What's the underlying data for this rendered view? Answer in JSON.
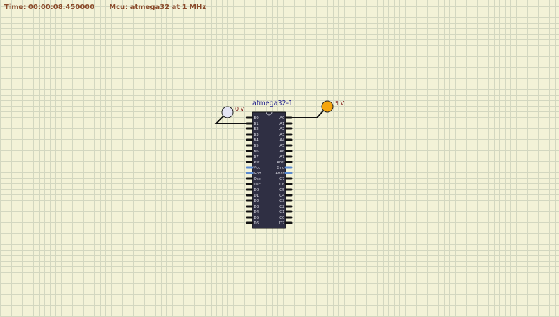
{
  "status": {
    "time": "Time: 00:00:08.450000",
    "mcu": "Mcu: atmega32 at 1 MHz"
  },
  "chip": {
    "name": "atmega32-1",
    "left_pins": [
      "B0",
      "B1",
      "B2",
      "B3",
      "B4",
      "B5",
      "B6",
      "B7",
      "Rst",
      "Vcc",
      "Gnd",
      "Osc",
      "Osc",
      "D0",
      "D1",
      "D2",
      "D3",
      "D4",
      "D5",
      "D6"
    ],
    "right_pins": [
      "A0",
      "A1",
      "A2",
      "A3",
      "A4",
      "A5",
      "A6",
      "A7",
      "Aref",
      "Gnd",
      "AVcc",
      "C7",
      "C6",
      "C5",
      "C4",
      "C3",
      "C2",
      "C1",
      "C0",
      "D7"
    ]
  },
  "probes": [
    {
      "id": "probe-left",
      "label": "0 V",
      "state": "low",
      "color": "#e4e4f4"
    },
    {
      "id": "probe-right",
      "label": "5 V",
      "state": "high",
      "color": "#f5a50c"
    }
  ],
  "colors": {
    "chip_body": "#2f2f43",
    "pin": "#111111",
    "power_pin": "#5a8ad0",
    "wire": "#111111",
    "status_text": "#8a4a2a"
  }
}
